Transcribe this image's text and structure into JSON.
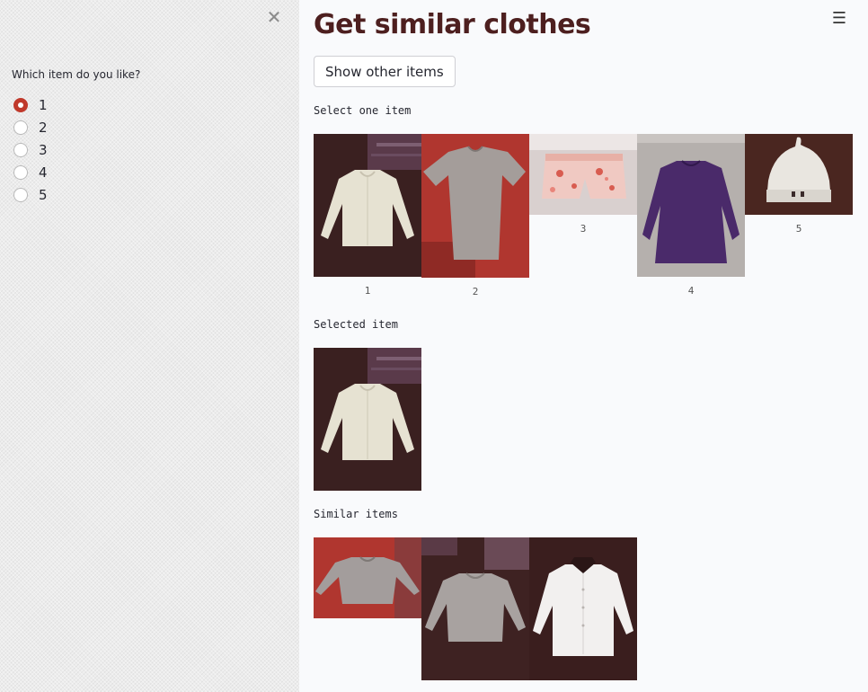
{
  "sidebar": {
    "close_icon": "close-icon",
    "radio_label": "Which item do you like?",
    "options": [
      "1",
      "2",
      "3",
      "4",
      "5"
    ],
    "selected": "1"
  },
  "main": {
    "menu_icon": "hamburger-menu-icon",
    "title": "Get similar clothes",
    "show_button": "Show other items",
    "select_caption": "Select one item",
    "items": [
      {
        "label": "1",
        "image": "cream cardigan on dark background"
      },
      {
        "label": "2",
        "image": "grey t-shirt on red background"
      },
      {
        "label": "3",
        "image": "pink floral shorts on light background"
      },
      {
        "label": "4",
        "image": "purple long-sleeve dress on grey background"
      },
      {
        "label": "5",
        "image": "white knit hat on dark background"
      }
    ],
    "selected_caption": "Selected item",
    "selected_image": "cream cardigan on dark background",
    "similar_caption": "Similar items",
    "similar_items": [
      {
        "image": "grey long-sleeve top on red background"
      },
      {
        "image": "grey sweater on dark background"
      },
      {
        "image": "white blouse with dark collar on dark background"
      }
    ]
  },
  "colors": {
    "accent": "#c0392b",
    "title": "#4d1f1f",
    "background": "#f9fafc",
    "sidebar": "#ececec"
  }
}
